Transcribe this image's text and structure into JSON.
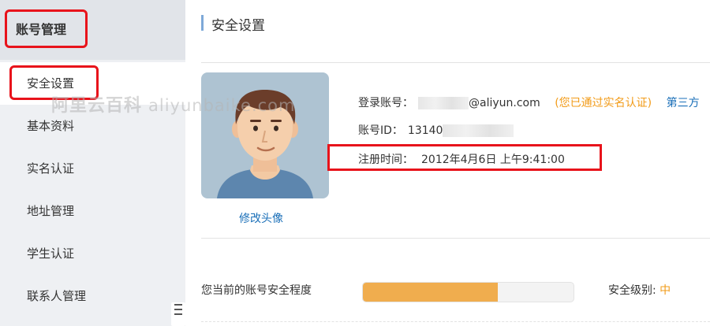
{
  "sidebar": {
    "title": "账号管理",
    "items": [
      {
        "label": "安全设置"
      },
      {
        "label": "基本资料"
      },
      {
        "label": "实名认证"
      },
      {
        "label": "地址管理"
      },
      {
        "label": "学生认证"
      },
      {
        "label": "联系人管理"
      }
    ],
    "collapse_icon": "collapse-icon"
  },
  "main": {
    "page_title": "安全设置",
    "change_avatar_label": "修改头像",
    "login_label": "登录账号：",
    "login_suffix": "@aliyun.com",
    "verified_open": "(",
    "verified_text": "您已通过实名认证",
    "verified_close": ")",
    "third_party_text": "第三方",
    "account_id_label": "账号ID：",
    "account_id_value": "13140",
    "register_label": "注册时间：",
    "register_value": "2012年4月6日 上午9:41:00",
    "security_label": "您当前的账号安全程度",
    "security_progress": 0.64,
    "security_level_label": "安全级别:",
    "security_level_value": "中"
  },
  "watermark": {
    "cn": "阿里云百科",
    "en": "aliyunbaike.com"
  },
  "colors": {
    "accent_orange": "#f0ad4e",
    "link_blue": "#1a6fb8",
    "highlight_red": "#e8131b",
    "verified_orange": "#f29b18"
  }
}
